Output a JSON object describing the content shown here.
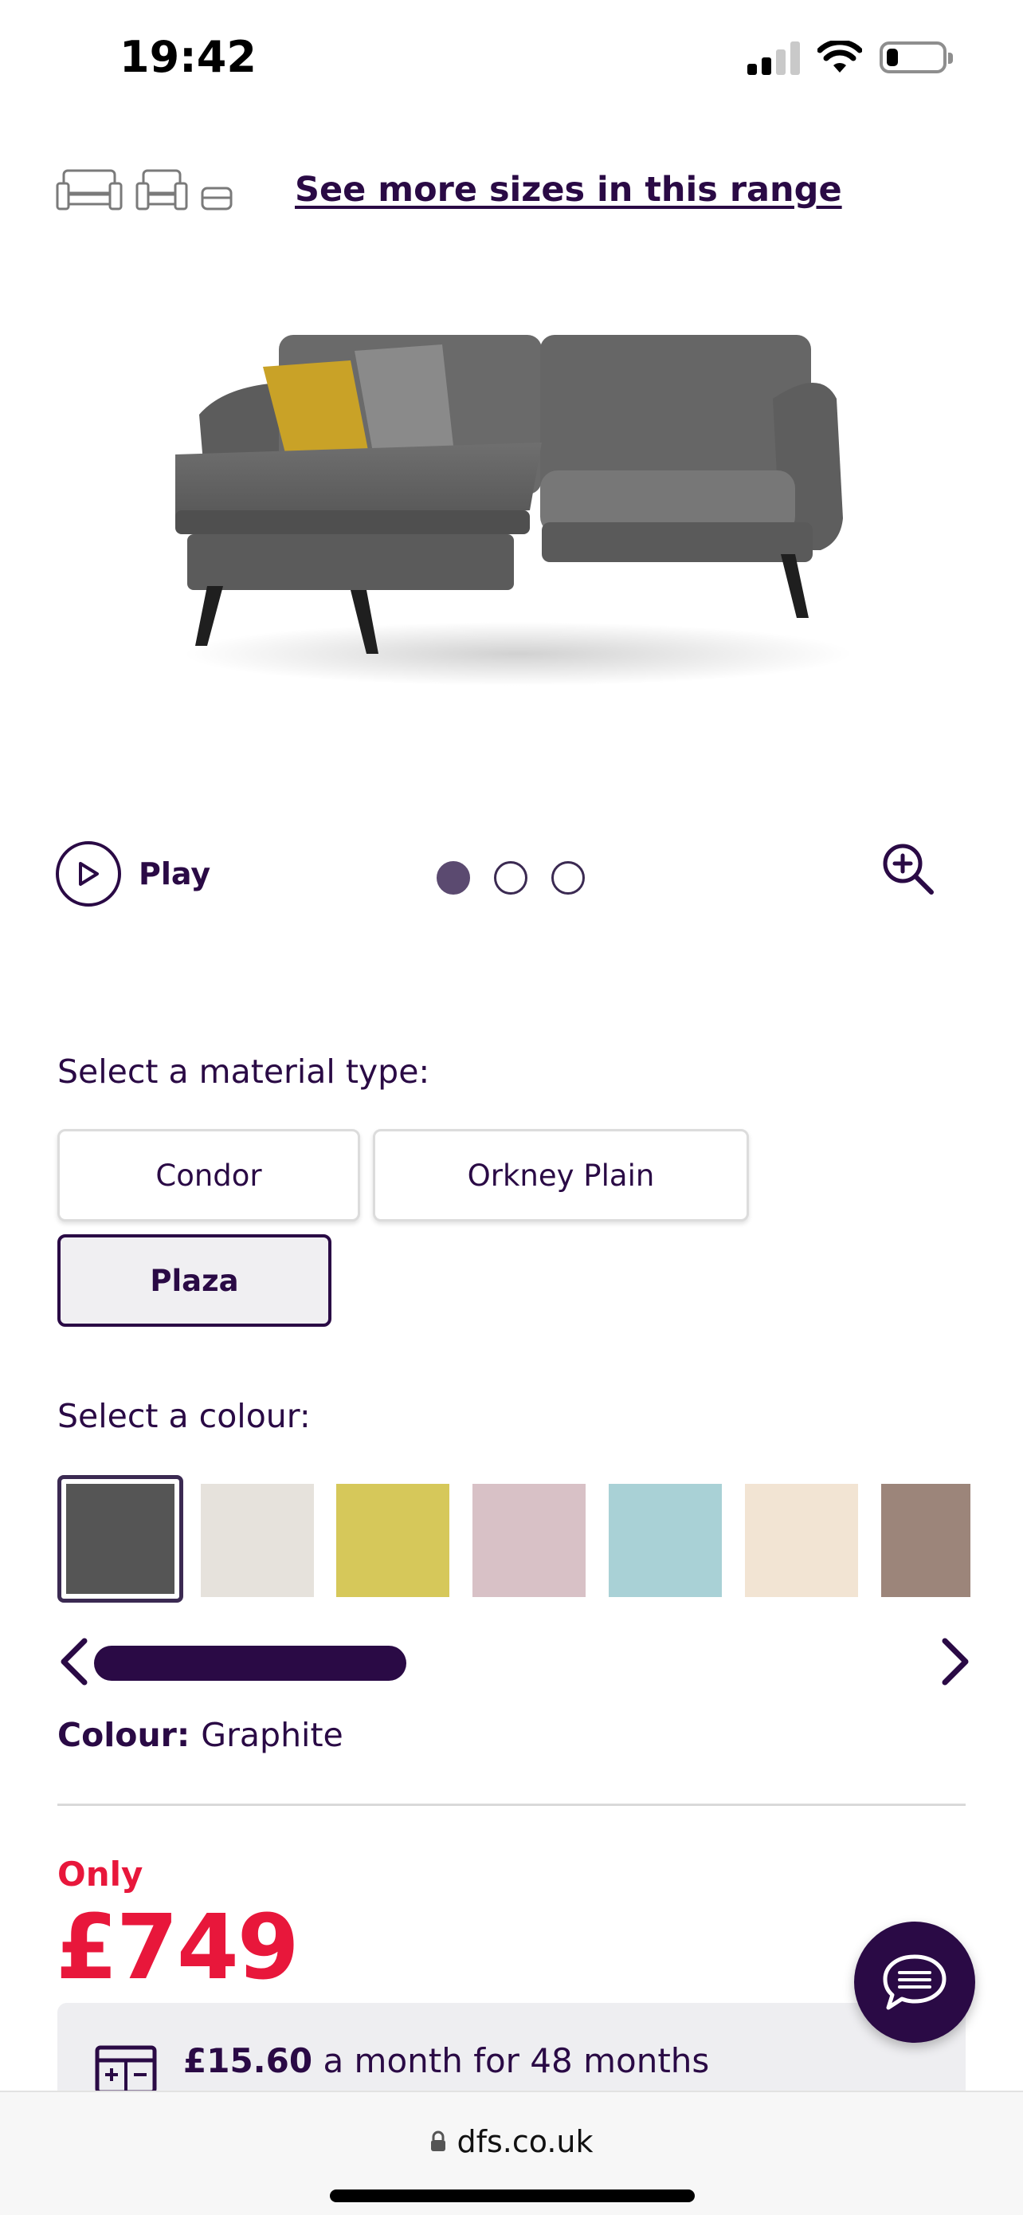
{
  "status_bar": {
    "time": "19:42"
  },
  "range": {
    "link_label": "See more sizes in this range"
  },
  "media": {
    "play_label": "Play",
    "dots_total": 3,
    "active_dot": 1
  },
  "material": {
    "heading": "Select a material type:",
    "options": [
      "Condor",
      "Orkney Plain",
      "Plaza"
    ],
    "selected": "Plaza"
  },
  "colour": {
    "heading": "Select a colour:",
    "swatches": [
      {
        "name": "Graphite",
        "color": "#555555",
        "selected": true
      },
      {
        "color": "#e6e2dc"
      },
      {
        "color": "#d6c85a"
      },
      {
        "color": "#d8c1c6"
      },
      {
        "color": "#a9d1d6"
      },
      {
        "color": "#f2e4d3"
      },
      {
        "color": "#9c857a"
      }
    ],
    "current_label": "Colour:",
    "current_value": "Graphite"
  },
  "pricing": {
    "prefix": "Only",
    "price": "£749",
    "finance_amount": "£15.60",
    "finance_text": "a month for 48 months"
  },
  "browser": {
    "url": "dfs.co.uk"
  },
  "colors": {
    "brand": "#2a0a45",
    "price_red": "#e8173b"
  }
}
